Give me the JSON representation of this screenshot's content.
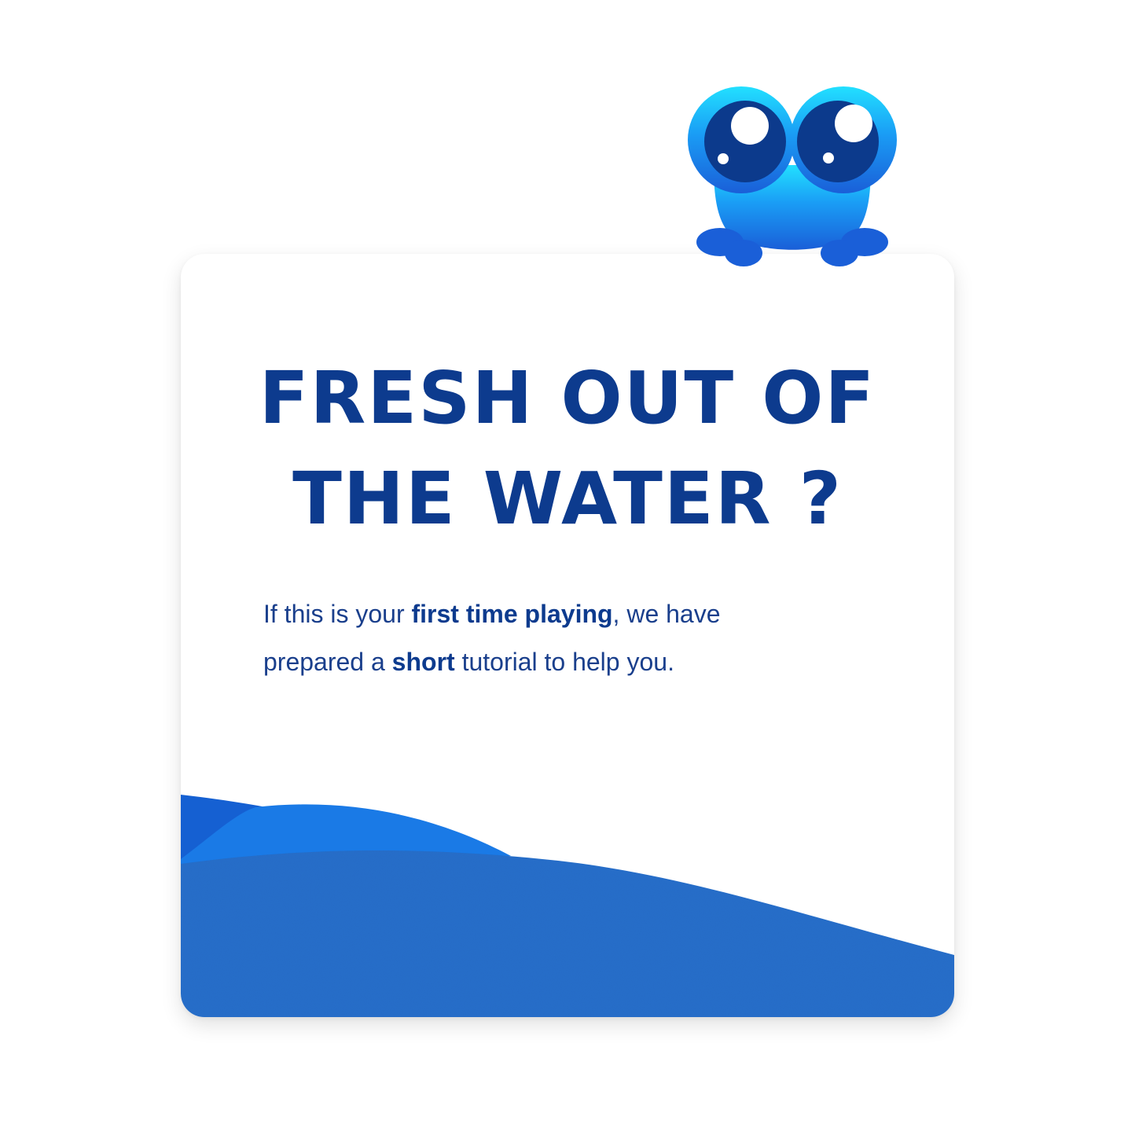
{
  "card": {
    "title_line_1": "FRESH OUT OF",
    "title_line_2": "THE WATER ?",
    "body": {
      "line1_pre": "If this is your ",
      "line1_bold": "first time playing",
      "line1_post": ", we have",
      "line2_pre": "prepared a ",
      "line2_bold": "short",
      "line2_post": " tutorial to help you."
    }
  },
  "mascot": {
    "icon": "frog-mascot-icon"
  },
  "colors": {
    "title": "#0d3b8e",
    "body_text": "#1a3f8c",
    "wave_back": "#1560d2",
    "wave_mid": "#1a7ae6",
    "wave_front": "#2a6fcc",
    "frog_top": "#22e0ff",
    "frog_bottom": "#1a5fd8",
    "frog_eye": "#0c3a8c"
  }
}
